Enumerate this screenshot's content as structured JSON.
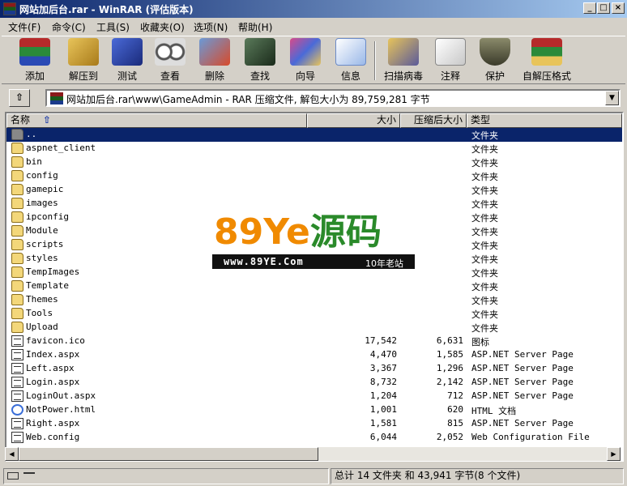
{
  "window": {
    "title": "网站加后台.rar - WinRAR (评估版本)",
    "controls": [
      "_",
      "□",
      "×"
    ]
  },
  "menu": [
    "文件(F)",
    "命令(C)",
    "工具(S)",
    "收藏夹(O)",
    "选项(N)",
    "帮助(H)"
  ],
  "toolbar": [
    {
      "label": "添加",
      "icon": "add-archive-icon"
    },
    {
      "label": "解压到",
      "icon": "extract-to-icon"
    },
    {
      "label": "测试",
      "icon": "test-icon"
    },
    {
      "label": "查看",
      "icon": "view-icon"
    },
    {
      "label": "删除",
      "icon": "delete-icon"
    },
    {
      "label": "查找",
      "icon": "find-icon"
    },
    {
      "label": "向导",
      "icon": "wizard-icon"
    },
    {
      "label": "信息",
      "icon": "info-icon"
    },
    {
      "label": "扫描病毒",
      "icon": "virus-scan-icon"
    },
    {
      "label": "注释",
      "icon": "comment-icon"
    },
    {
      "label": "保护",
      "icon": "protect-icon"
    },
    {
      "label": "自解压格式",
      "icon": "sfx-icon"
    }
  ],
  "address": {
    "up_label": "⇧",
    "path": "网站加后台.rar\\www\\GameAdmin - RAR 压缩文件, 解包大小为 89,759,281 字节",
    "dropdown": "▼"
  },
  "columns": {
    "name": "名称",
    "sort_arrow": "⇧",
    "size": "大小",
    "packed": "压缩后大小",
    "type": "类型"
  },
  "rows": [
    {
      "name": "..",
      "size": "",
      "packed": "",
      "type": "文件夹",
      "kind": "up",
      "selected": true
    },
    {
      "name": "aspnet_client",
      "size": "",
      "packed": "",
      "type": "文件夹",
      "kind": "folder"
    },
    {
      "name": "bin",
      "size": "",
      "packed": "",
      "type": "文件夹",
      "kind": "folder"
    },
    {
      "name": "config",
      "size": "",
      "packed": "",
      "type": "文件夹",
      "kind": "folder"
    },
    {
      "name": "gamepic",
      "size": "",
      "packed": "",
      "type": "文件夹",
      "kind": "folder"
    },
    {
      "name": "images",
      "size": "",
      "packed": "",
      "type": "文件夹",
      "kind": "folder"
    },
    {
      "name": "ipconfig",
      "size": "",
      "packed": "",
      "type": "文件夹",
      "kind": "folder"
    },
    {
      "name": "Module",
      "size": "",
      "packed": "",
      "type": "文件夹",
      "kind": "folder"
    },
    {
      "name": "scripts",
      "size": "",
      "packed": "",
      "type": "文件夹",
      "kind": "folder"
    },
    {
      "name": "styles",
      "size": "",
      "packed": "",
      "type": "文件夹",
      "kind": "folder"
    },
    {
      "name": "TempImages",
      "size": "",
      "packed": "",
      "type": "文件夹",
      "kind": "folder"
    },
    {
      "name": "Template",
      "size": "",
      "packed": "",
      "type": "文件夹",
      "kind": "folder"
    },
    {
      "name": "Themes",
      "size": "",
      "packed": "",
      "type": "文件夹",
      "kind": "folder"
    },
    {
      "name": "Tools",
      "size": "",
      "packed": "",
      "type": "文件夹",
      "kind": "folder"
    },
    {
      "name": "Upload",
      "size": "",
      "packed": "",
      "type": "文件夹",
      "kind": "folder"
    },
    {
      "name": "favicon.ico",
      "size": "17,542",
      "packed": "6,631",
      "type": "图标",
      "kind": "doc"
    },
    {
      "name": "Index.aspx",
      "size": "4,470",
      "packed": "1,585",
      "type": "ASP.NET Server Page",
      "kind": "doc"
    },
    {
      "name": "Left.aspx",
      "size": "3,367",
      "packed": "1,296",
      "type": "ASP.NET Server Page",
      "kind": "doc"
    },
    {
      "name": "Login.aspx",
      "size": "8,732",
      "packed": "2,142",
      "type": "ASP.NET Server Page",
      "kind": "doc"
    },
    {
      "name": "LoginOut.aspx",
      "size": "1,204",
      "packed": "712",
      "type": "ASP.NET Server Page",
      "kind": "doc"
    },
    {
      "name": "NotPower.html",
      "size": "1,001",
      "packed": "620",
      "type": "HTML 文档",
      "kind": "ie"
    },
    {
      "name": "Right.aspx",
      "size": "1,581",
      "packed": "815",
      "type": "ASP.NET Server Page",
      "kind": "doc"
    },
    {
      "name": "Web.config",
      "size": "6,044",
      "packed": "2,052",
      "type": "Web Configuration File",
      "kind": "doc"
    }
  ],
  "watermark": {
    "logo": "89Ye源码",
    "url": "www.89YE.Com",
    "tag": "10年老站"
  },
  "status": {
    "left": "",
    "right": "总计 14 文件夹 和 43,941 字节(8 个文件)"
  },
  "colors": {
    "selection": "#0a246a",
    "title_gradient_start": "#0a246a",
    "title_gradient_end": "#a6caf0",
    "watermark_orange": "#f08a00",
    "watermark_green": "#2a8a2a"
  }
}
